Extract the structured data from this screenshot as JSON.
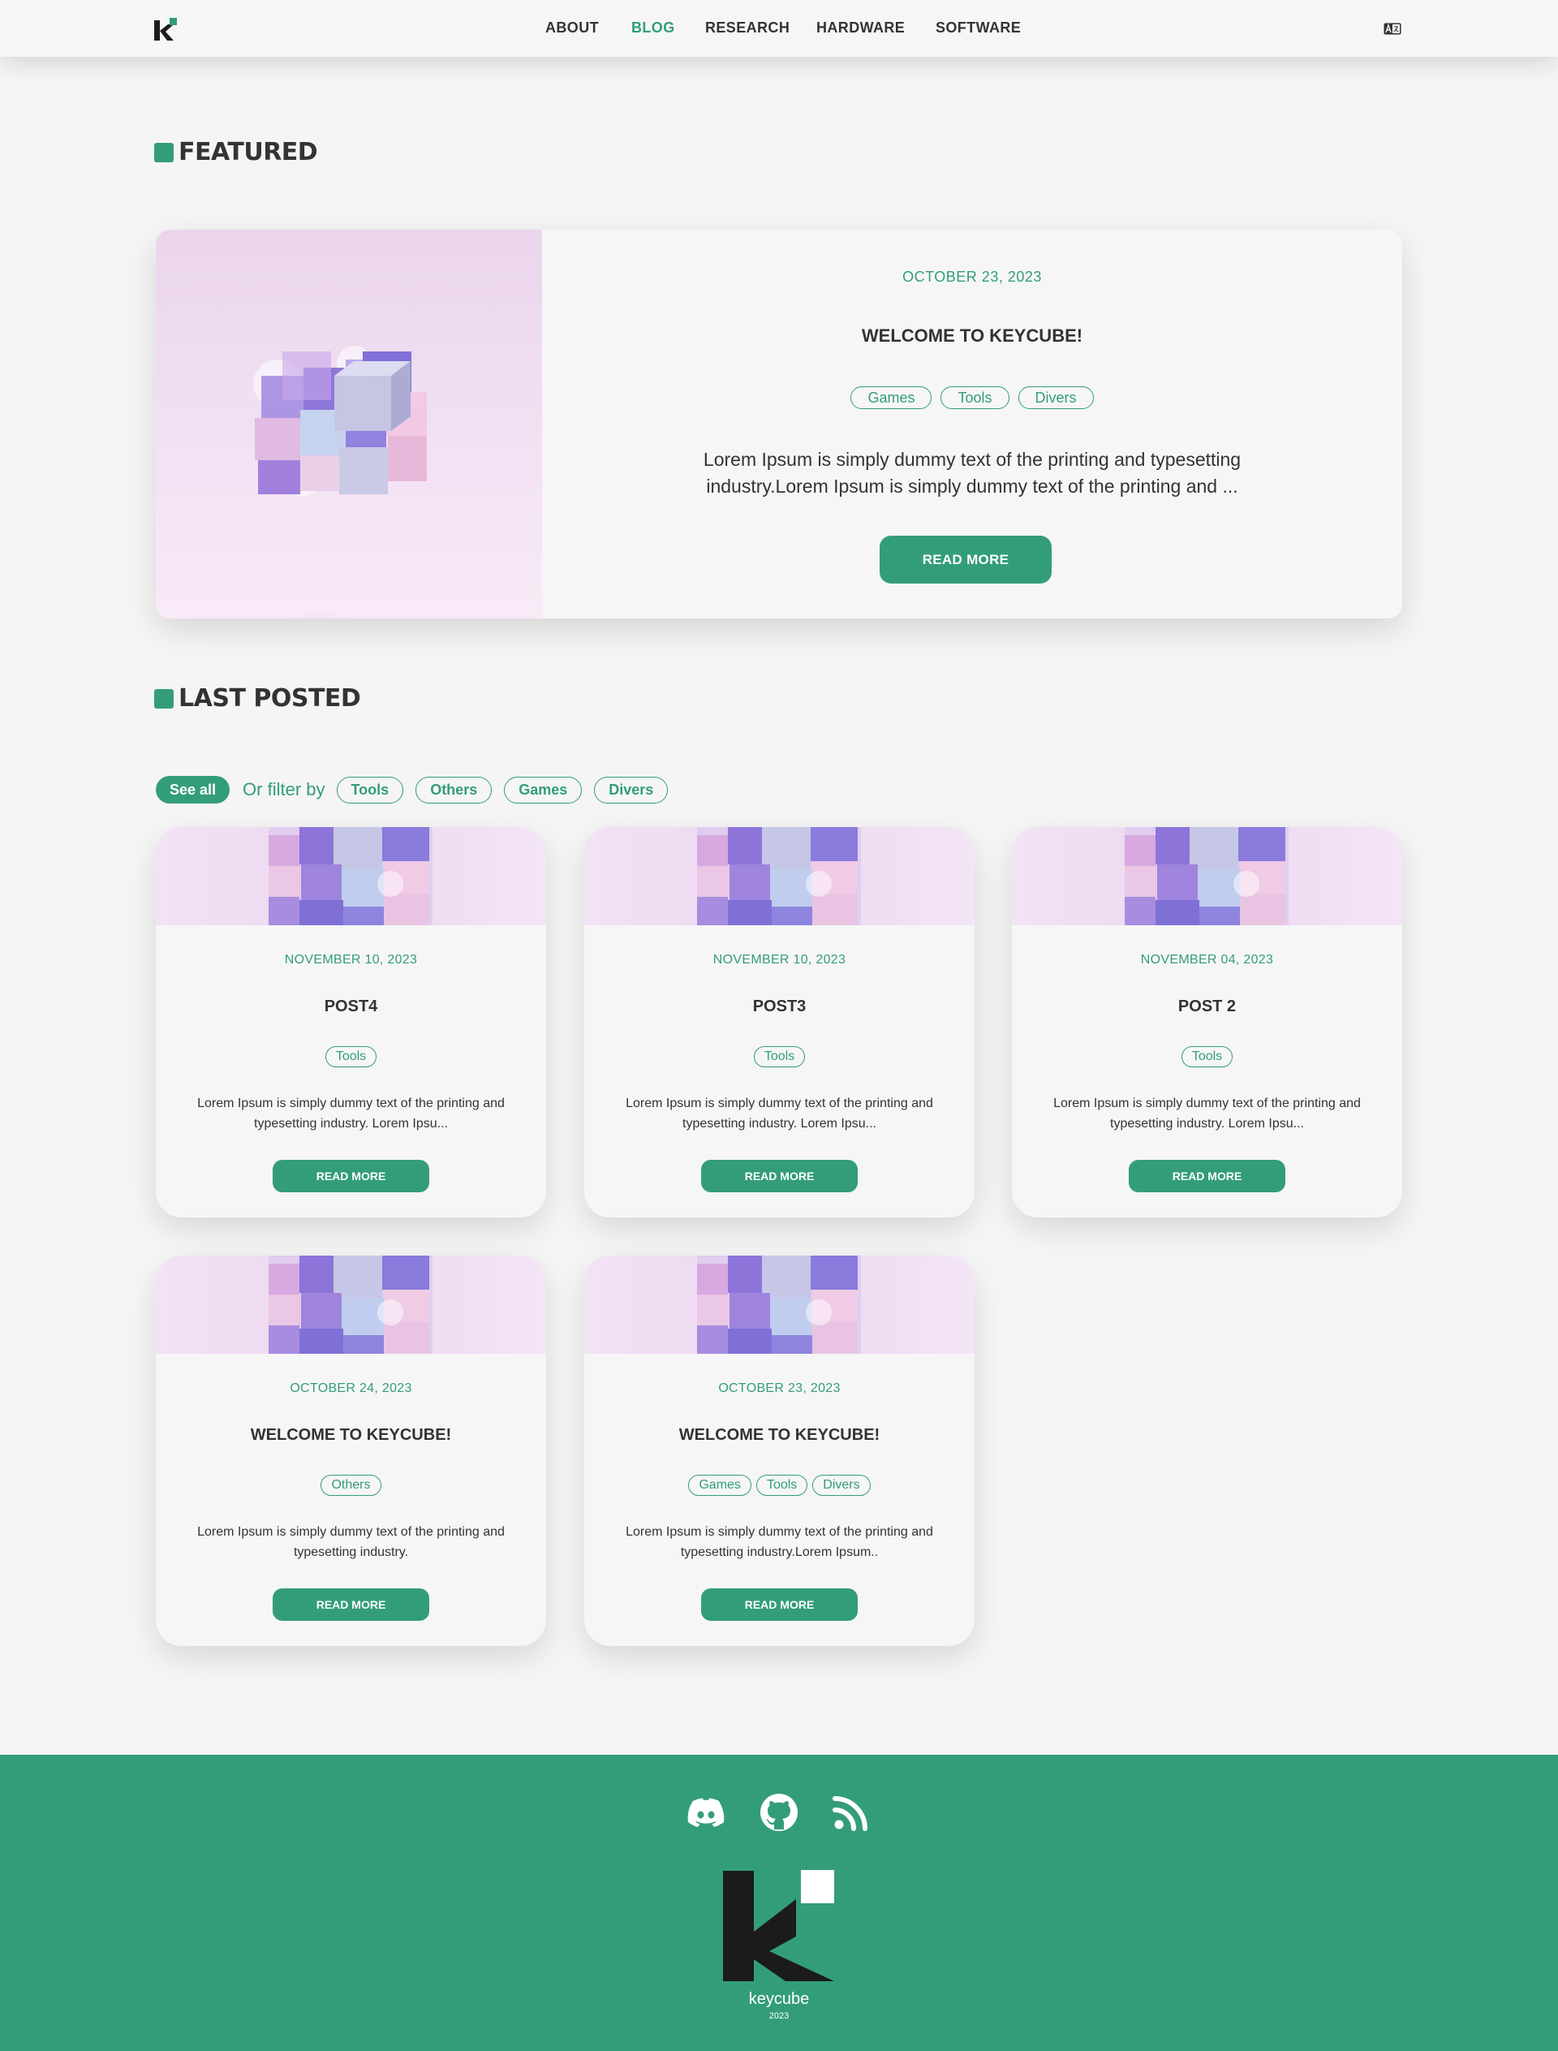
{
  "nav": {
    "items": [
      {
        "label": "ABOUT",
        "active": false
      },
      {
        "label": "BLOG",
        "active": true
      },
      {
        "label": "RESEARCH",
        "active": false
      },
      {
        "label": "HARDWARE",
        "active": false
      },
      {
        "label": "SOFTWARE",
        "active": false
      }
    ],
    "language_icon": "language-icon"
  },
  "colors": {
    "accent": "#339d7b",
    "text": "#333333",
    "background": "#f5f5f5"
  },
  "featured": {
    "heading": "FEATURED",
    "post": {
      "date": "OCTOBER 23, 2023",
      "title": "WELCOME TO KEYCUBE!",
      "tags": [
        "Games",
        "Tools",
        "Divers"
      ],
      "excerpt": "Lorem Ipsum is simply dummy text of the printing and typesetting industry.Lorem Ipsum is simply dummy text of the printing and ...",
      "button": "READ MORE"
    }
  },
  "last_posted": {
    "heading": "LAST POSTED",
    "filter": {
      "see_all": "See all",
      "label": "Or filter by",
      "options": [
        "Tools",
        "Others",
        "Games",
        "Divers"
      ]
    },
    "posts": [
      {
        "date": "NOVEMBER 10, 2023",
        "title": "POST4",
        "tags": [
          "Tools"
        ],
        "excerpt": "Lorem Ipsum is simply dummy text of the printing and typesetting industry. Lorem Ipsu...",
        "button": "READ MORE"
      },
      {
        "date": "NOVEMBER 10, 2023",
        "title": "POST3",
        "tags": [
          "Tools"
        ],
        "excerpt": "Lorem Ipsum is simply dummy text of the printing and typesetting industry. Lorem Ipsu...",
        "button": "READ MORE"
      },
      {
        "date": "NOVEMBER 04, 2023",
        "title": "POST 2",
        "tags": [
          "Tools"
        ],
        "excerpt": "Lorem Ipsum is simply dummy text of the printing and typesetting industry. Lorem Ipsu...",
        "button": "READ MORE"
      },
      {
        "date": "OCTOBER 24, 2023",
        "title": "WELCOME TO KEYCUBE!",
        "tags": [
          "Others"
        ],
        "excerpt": "Lorem Ipsum is simply dummy text of the printing and typesetting industry.",
        "button": "READ MORE"
      },
      {
        "date": "OCTOBER 23, 2023",
        "title": "WELCOME TO KEYCUBE!",
        "tags": [
          "Games",
          "Tools",
          "Divers"
        ],
        "excerpt": "Lorem Ipsum is simply dummy text of the printing and typesetting industry.Lorem Ipsum..",
        "button": "READ MORE"
      }
    ]
  },
  "footer": {
    "social_icons": [
      "discord-icon",
      "github-icon",
      "rss-icon"
    ],
    "brand": "keycube",
    "year": "2023"
  }
}
